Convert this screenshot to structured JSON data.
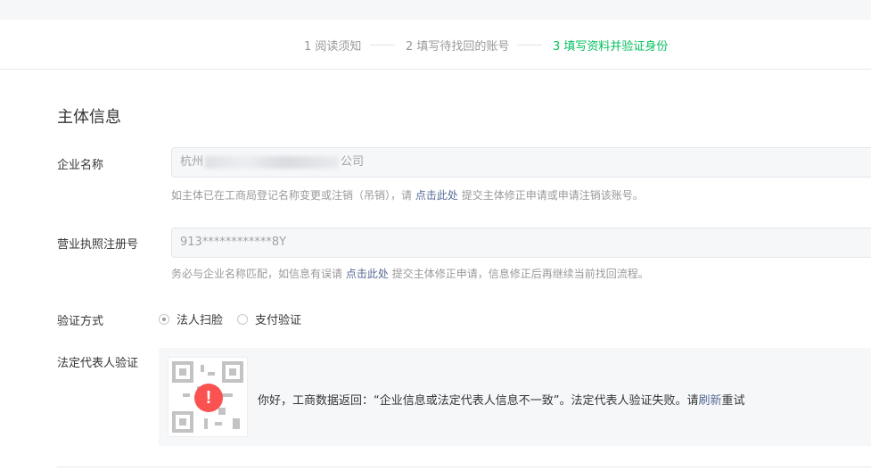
{
  "steps": [
    {
      "label": "1 阅读须知",
      "state": "done"
    },
    {
      "label": "2 填写待找回的账号",
      "state": "done"
    },
    {
      "label": "3 填写资料并验证身份",
      "state": "active"
    }
  ],
  "colors": {
    "accent": "#07c160",
    "link": "#576b95",
    "error": "#fa5151"
  },
  "section": {
    "title": "主体信息"
  },
  "company": {
    "label": "企业名称",
    "value_prefix": "杭州",
    "value_suffix": "公司",
    "hint_before": "如主体已在工商局登记名称变更或注销（吊销），请",
    "hint_link": "点击此处",
    "hint_after": "提交主体修正申请或申请注销该账号。"
  },
  "license": {
    "label": "营业执照注册号",
    "value": "913************8Y",
    "hint_before": "务必与企业名称匹配，如信息有误请",
    "hint_link": "点击此处",
    "hint_after": "提交主体修正申请，信息修正后再继续当前找回流程。"
  },
  "verify_method": {
    "label": "验证方式",
    "options": [
      {
        "label": "法人扫脸",
        "checked": true
      },
      {
        "label": "支付验证",
        "checked": false
      }
    ]
  },
  "legal_rep": {
    "label": "法定代表人验证",
    "alert_icon": "exclamation-icon",
    "alert_glyph": "!",
    "message_before": "你好，工商数据返回：“企业信息或法定代表人信息不一致”。法定代表人验证失败。请",
    "message_link": "刷新",
    "message_after": "重试"
  }
}
